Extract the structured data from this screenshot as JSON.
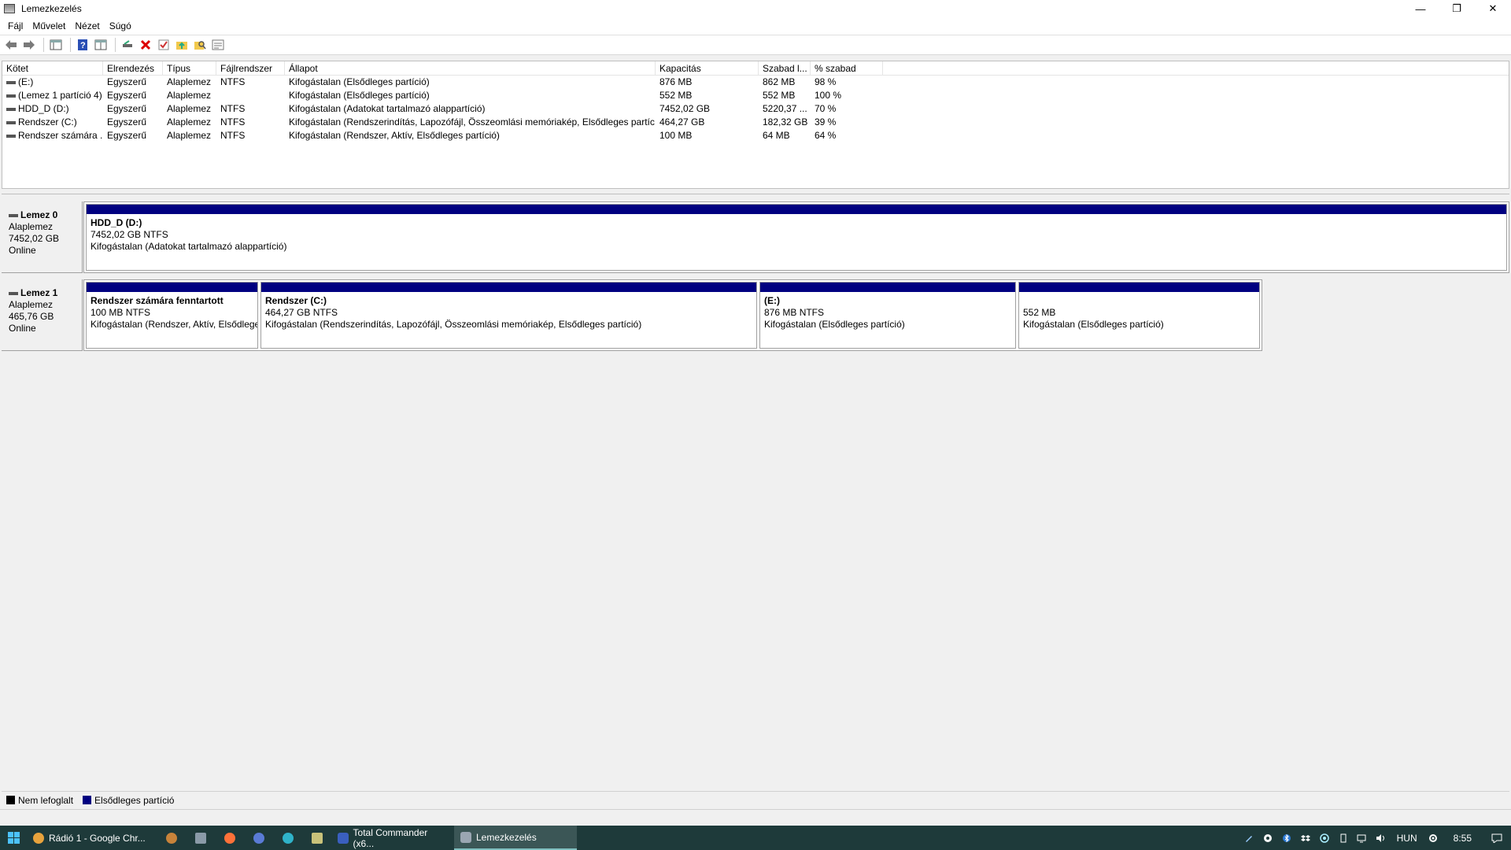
{
  "window": {
    "title": "Lemezkezelés",
    "controls": [
      "—",
      "❐",
      "✕"
    ]
  },
  "menu": [
    "Fájl",
    "Művelet",
    "Nézet",
    "Súgó"
  ],
  "toolbar": {
    "icons": [
      "back-icon",
      "forward-icon",
      "console-icon",
      "help-icon",
      "properties-icon",
      "connect-icon",
      "delete-icon",
      "check-icon",
      "folder-up-icon",
      "search-folder-icon",
      "settings-icon"
    ]
  },
  "volume_list": {
    "headers": [
      "Kötet",
      "Elrendezés",
      "Típus",
      "Fájlrendszer",
      "Állapot",
      "Kapacitás",
      "Szabad l...",
      "% szabad"
    ],
    "rows": [
      [
        "(E:)",
        "Egyszerű",
        "Alaplemez",
        "NTFS",
        "Kifogástalan (Elsődleges partíció)",
        "876 MB",
        "862 MB",
        "98 %"
      ],
      [
        "(Lemez 1 partíció 4)",
        "Egyszerű",
        "Alaplemez",
        "",
        "Kifogástalan (Elsődleges partíció)",
        "552 MB",
        "552 MB",
        "100 %"
      ],
      [
        "HDD_D (D:)",
        "Egyszerű",
        "Alaplemez",
        "NTFS",
        "Kifogástalan (Adatokat tartalmazó alappartíció)",
        "7452,02 GB",
        "5220,37 ...",
        "70 %"
      ],
      [
        "Rendszer (C:)",
        "Egyszerű",
        "Alaplemez",
        "NTFS",
        "Kifogástalan (Rendszerindítás, Lapozófájl, Összeomlási memóriakép, Elsődleges partíc...",
        "464,27 GB",
        "182,32 GB",
        "39 %"
      ],
      [
        "Rendszer számára ...",
        "Egyszerű",
        "Alaplemez",
        "NTFS",
        "Kifogástalan (Rendszer, Aktív, Elsődleges partíció)",
        "100 MB",
        "64 MB",
        "64 %"
      ]
    ]
  },
  "disks": [
    {
      "name": "Lemez 0",
      "type": "Alaplemez",
      "size": "7452,02 GB",
      "status": "Online",
      "partitions": [
        {
          "name": "HDD_D  (D:)",
          "size": "7452,02 GB NTFS",
          "status": "Kifogástalan (Adatokat tartalmazó alappartíció)"
        }
      ]
    },
    {
      "name": "Lemez 1",
      "type": "Alaplemez",
      "size": "465,76 GB",
      "status": "Online",
      "partitions": [
        {
          "name": "Rendszer számára fenntartott",
          "size": "100 MB NTFS",
          "status": "Kifogástalan (Rendszer, Aktív, Elsődlege"
        },
        {
          "name": "Rendszer  (C:)",
          "size": "464,27 GB NTFS",
          "status": "Kifogástalan (Rendszerindítás, Lapozófájl, Összeomlási memóriakép, Elsődleges partíció)"
        },
        {
          "name": "(E:)",
          "size": "876 MB NTFS",
          "status": "Kifogástalan (Elsődleges partíció)"
        },
        {
          "name": "",
          "size": "552 MB",
          "status": "Kifogástalan (Elsődleges partíció)"
        }
      ]
    }
  ],
  "legend": [
    {
      "label": "Nem lefoglalt",
      "color": "#000000"
    },
    {
      "label": "Elsődleges partíció",
      "color": "#000080"
    }
  ],
  "taskbar": {
    "apps": [
      {
        "label": "Rádió 1 - Google Chr...",
        "icon": "chrome-icon",
        "color": "#e8a33d"
      },
      {
        "label": "Total Commander (x6...",
        "icon": "total-commander-icon",
        "color": "#3a5fbf"
      },
      {
        "label": "Lemezkezelés",
        "icon": "disk-management-icon",
        "color": "#9aa6b2"
      }
    ],
    "pinned": [
      "settings-gear-app-icon",
      "calculator-icon",
      "firefox-icon",
      "web-app-icon",
      "edge-icon",
      "notepad-icon"
    ],
    "tray": [
      "pen-icon",
      "app-tray-icon",
      "bluetooth-icon",
      "dropbox-icon",
      "network-app-icon",
      "usb-icon",
      "wifi-icon",
      "volume-icon"
    ],
    "language": "HUN",
    "time": "8:55"
  }
}
